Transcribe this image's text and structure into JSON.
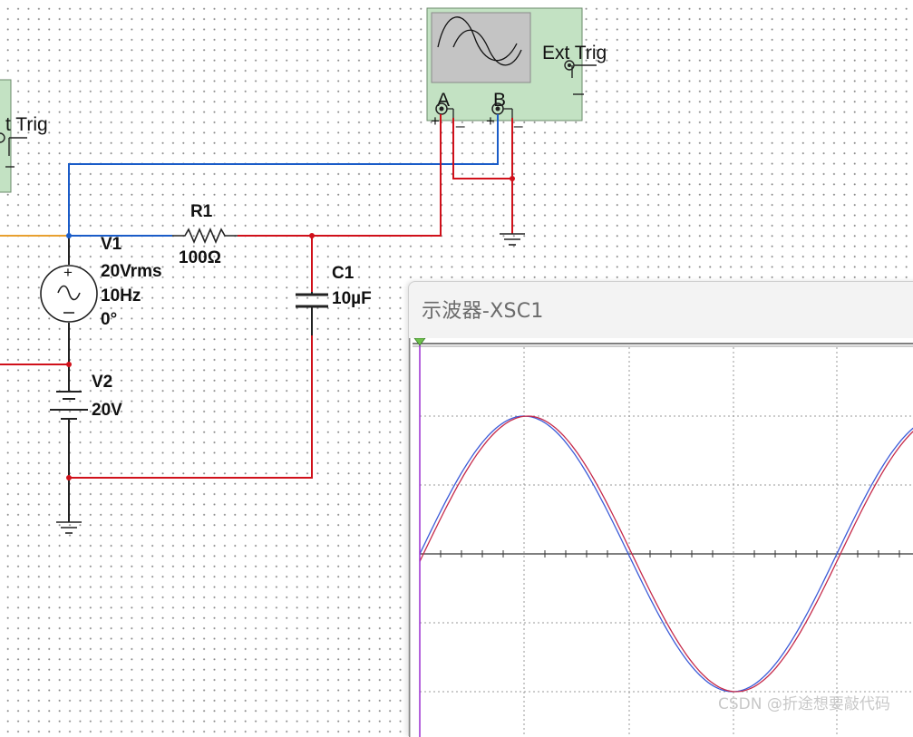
{
  "components": {
    "v1": {
      "name": "V1",
      "amplitude": "20Vrms",
      "frequency": "10Hz",
      "phase": "0°"
    },
    "v2": {
      "name": "V2",
      "voltage": "20V"
    },
    "r1": {
      "name": "R1",
      "value": "100Ω"
    },
    "c1": {
      "name": "C1",
      "value": "10µF"
    }
  },
  "oscilloscope": {
    "ext_trig_label": "Ext Trig",
    "left_ext_trig_label": "t Trig",
    "channel_a": "A",
    "channel_b": "B",
    "plus": "+",
    "minus": "_"
  },
  "scope_window": {
    "title": "示波器-XSC1"
  },
  "watermark": "CSDN @折途想要敲代码",
  "colors": {
    "wire_red": "#d0101a",
    "wire_blue": "#1a5cc8",
    "wire_orange": "#e8a030",
    "scope_body": "#c3e2c3",
    "trace_blue": "#3b5bd8",
    "trace_red": "#c62a4a",
    "cursor": "#9b2fd1"
  }
}
